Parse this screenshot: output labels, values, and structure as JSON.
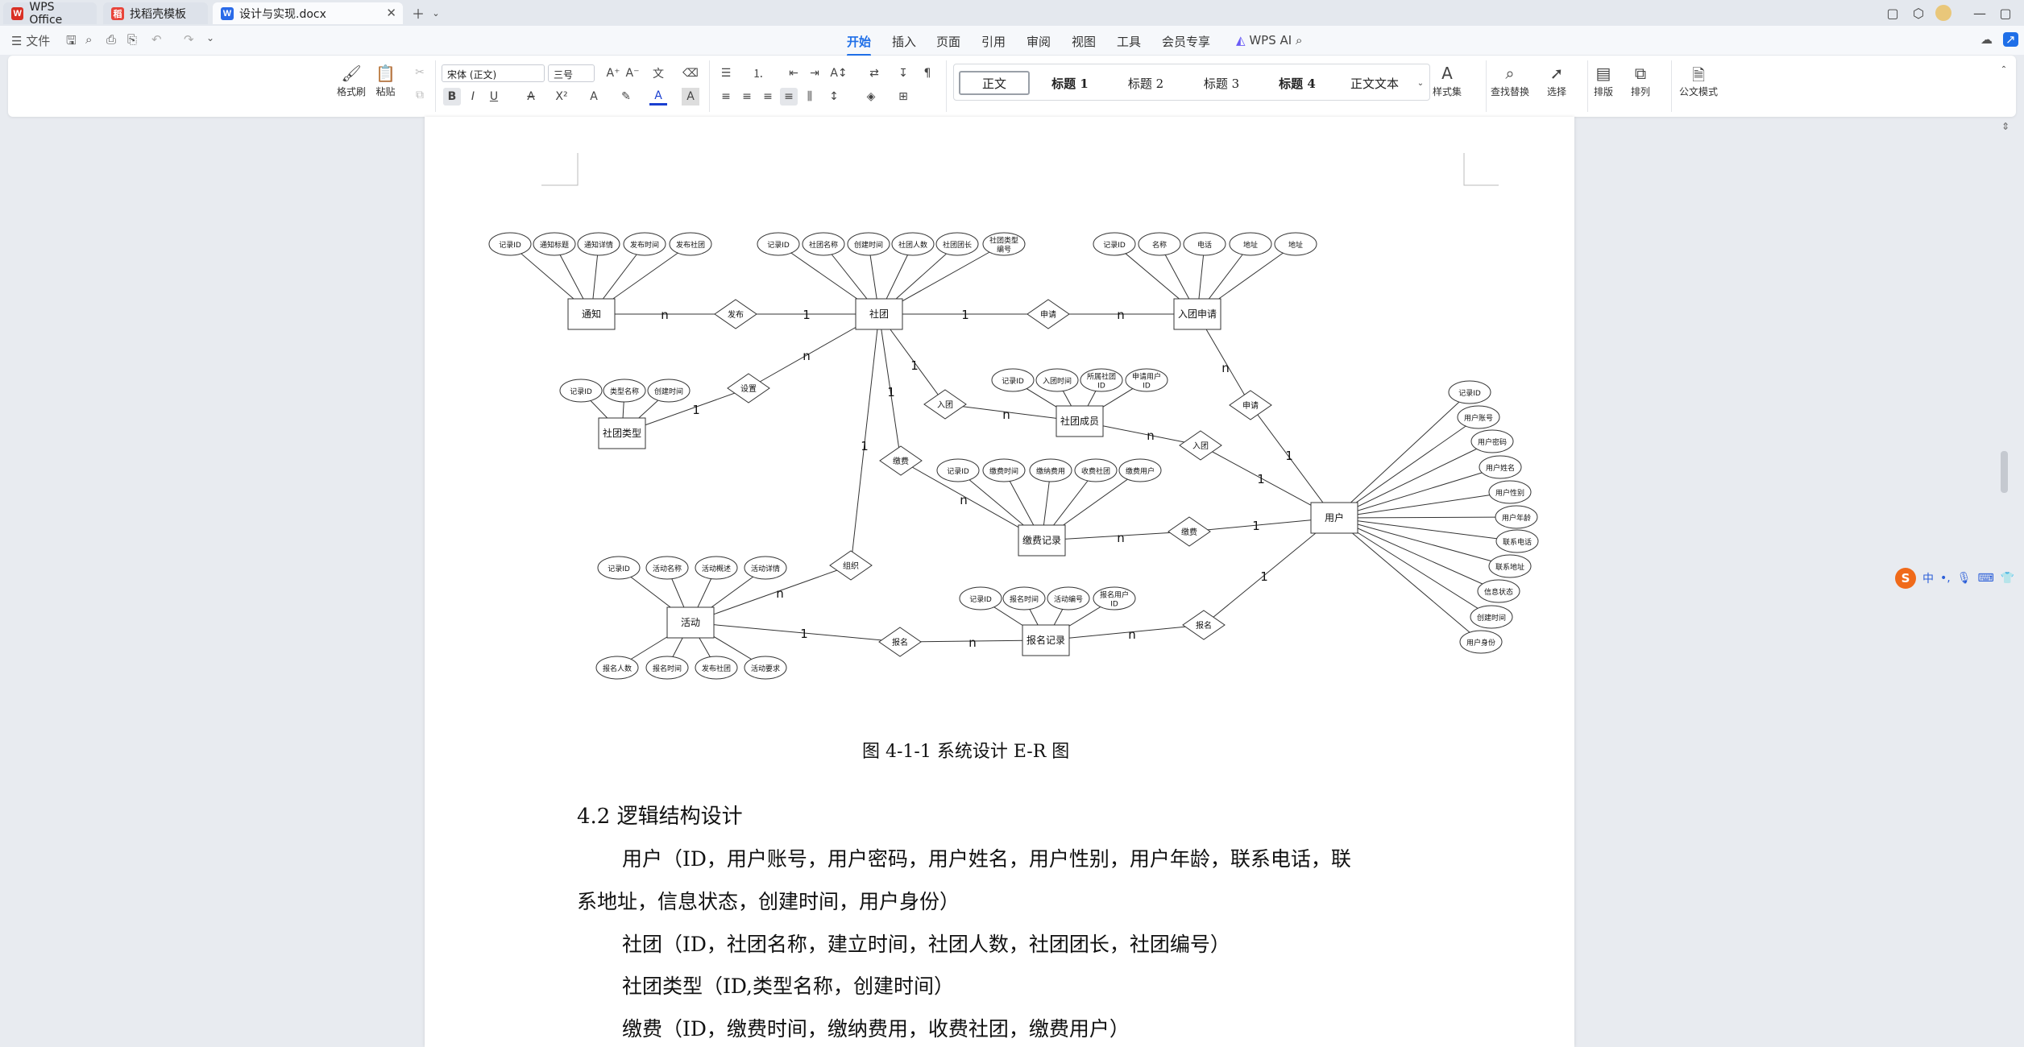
{
  "tabs": [
    {
      "label": "WPS Office",
      "icon": "W",
      "color": "#d93025"
    },
    {
      "label": "找稻壳模板",
      "icon": "稻",
      "color": "#e8443a"
    },
    {
      "label": "设计与实现.docx",
      "icon": "W",
      "color": "#2a6ae8"
    }
  ],
  "menu": {
    "file": "文件",
    "items": [
      "开始",
      "插入",
      "页面",
      "引用",
      "审阅",
      "视图",
      "工具",
      "会员专享"
    ],
    "ai": "WPS AI"
  },
  "ribbon": {
    "format_painter": "格式刷",
    "paste": "粘贴",
    "font_name": "宋体 (正文)",
    "font_size": "三号",
    "styles": [
      "正文",
      "标题 1",
      "标题 2",
      "标题 3",
      "标题 4",
      "正文文本"
    ],
    "style_set": "样式集",
    "find_replace": "查找替换",
    "select": "选择",
    "arrange": "排版",
    "sort": "排列",
    "formula_mode": "公文模式"
  },
  "diagram": {
    "entities": {
      "notice": "通知",
      "club": "社团",
      "join_app": "入团申请",
      "club_type": "社团类型",
      "member": "社团成员",
      "fee_record": "缴费记录",
      "user": "用户",
      "activity": "活动",
      "signup": "报名记录"
    },
    "relations": {
      "publish": "发布",
      "apply1": "申请",
      "set": "设置",
      "join1": "入团",
      "apply2": "申请",
      "fee1": "缴费",
      "join2": "入团",
      "fee2": "缴费",
      "organize": "组织",
      "signup1": "报名",
      "signup2": "报名"
    },
    "attrs": {
      "notice": [
        "记录ID",
        "通知标题",
        "通知详情",
        "发布时间",
        "发布社团"
      ],
      "club": [
        "记录ID",
        "社团名称",
        "创建时间",
        "社团人数",
        "社团团长",
        "社团类型编号"
      ],
      "join_app": [
        "记录ID",
        "名称",
        "电话",
        "地址",
        "地址"
      ],
      "club_type": [
        "记录ID",
        "类型名称",
        "创建时间"
      ],
      "member": [
        "记录ID",
        "入团时间",
        "所属社团ID",
        "申请用户ID"
      ],
      "fee_record": [
        "记录ID",
        "缴费时间",
        "缴纳费用",
        "收费社团",
        "缴费用户"
      ],
      "user": [
        "记录ID",
        "用户账号",
        "用户密码",
        "用户姓名",
        "用户性别",
        "用户年龄",
        "联系电话",
        "联系地址",
        "信息状态",
        "创建时间",
        "用户身份"
      ],
      "activity_top": [
        "记录ID",
        "活动名称",
        "活动概述",
        "活动详情"
      ],
      "activity_bottom": [
        "报名人数",
        "报名时间",
        "发布社团",
        "活动要求"
      ],
      "signup": [
        "记录ID",
        "报名时间",
        "活动编号",
        "报名用户ID"
      ]
    },
    "card": {
      "one": "1",
      "many": "n"
    }
  },
  "doc": {
    "caption": "图 4-1-1 系统设计 E-R 图",
    "heading": "4.2 逻辑结构设计",
    "p1_line1": "用户（ID，用户账号，用户密码，用户姓名，用户性别，用户年龄，联系电话，联",
    "p1_line2": "系地址，信息状态，创建时间，用户身份）",
    "p2": "社团（ID，社团名称，建立时间，社团人数，社团团长，社团编号）",
    "p3": "社团类型（ID,类型名称，创建时间）",
    "p4": "缴费（ID，缴费时间，缴纳费用，收费社团，缴费用户）"
  },
  "ime": {
    "lang": "中"
  }
}
